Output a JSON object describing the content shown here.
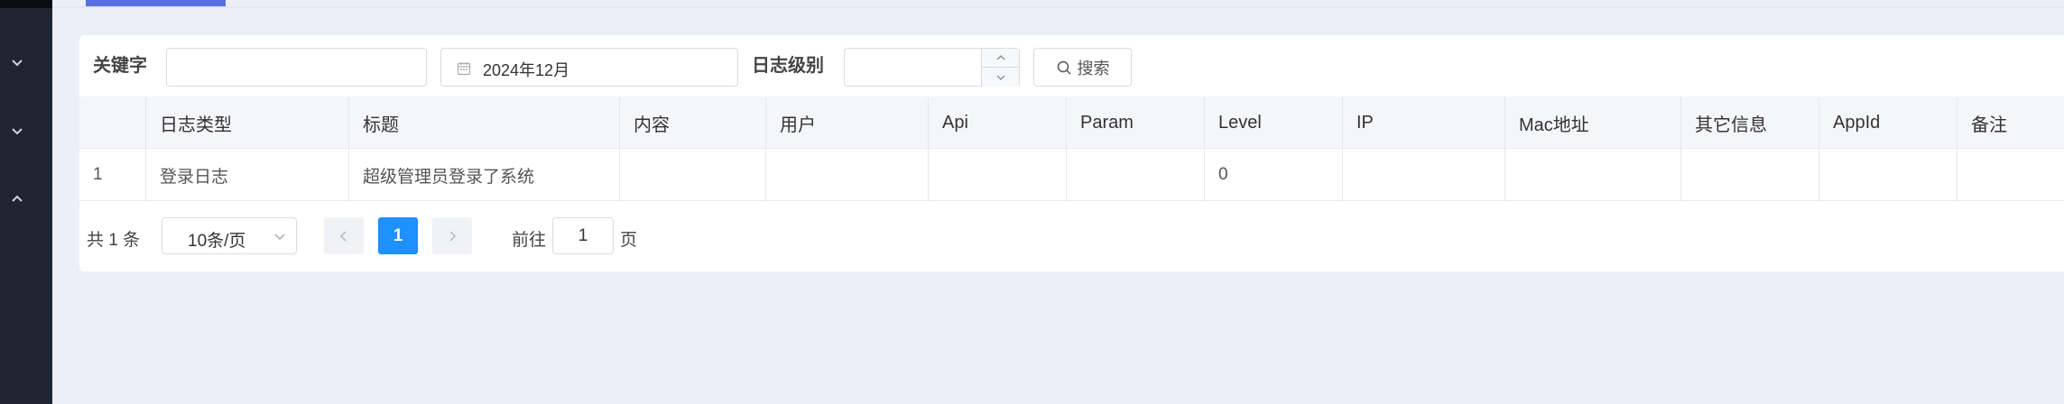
{
  "filters": {
    "keyword_label": "关键字",
    "keyword_value": "",
    "date_value": "2024年12月",
    "level_label": "日志级别",
    "level_value": "",
    "search_label": "搜索"
  },
  "table": {
    "columns": [
      "",
      "日志类型",
      "标题",
      "内容",
      "用户",
      "Api",
      "Param",
      "Level",
      "IP",
      "Mac地址",
      "其它信息",
      "AppId",
      "备注"
    ],
    "rows": [
      [
        "1",
        "登录日志",
        "超级管理员登录了系统",
        "",
        "",
        "",
        "",
        "0",
        "",
        "",
        "",
        "",
        ""
      ]
    ]
  },
  "pagination": {
    "total_text": "共 1 条",
    "page_size": "10条/页",
    "current_page": "1",
    "goto_prefix": "前往",
    "goto_value": "1",
    "goto_suffix": "页"
  },
  "icons": {
    "sidebar": [
      "chevron-down-icon",
      "chevron-down-icon",
      "chevron-up-icon"
    ],
    "date": "calendar-icon",
    "search": "search-icon"
  },
  "colors": {
    "sidebar_bg": "#1f2433",
    "active_tab": "#5b6fe0",
    "pager_active": "#1e90ff",
    "page_bg": "#eceff7"
  }
}
